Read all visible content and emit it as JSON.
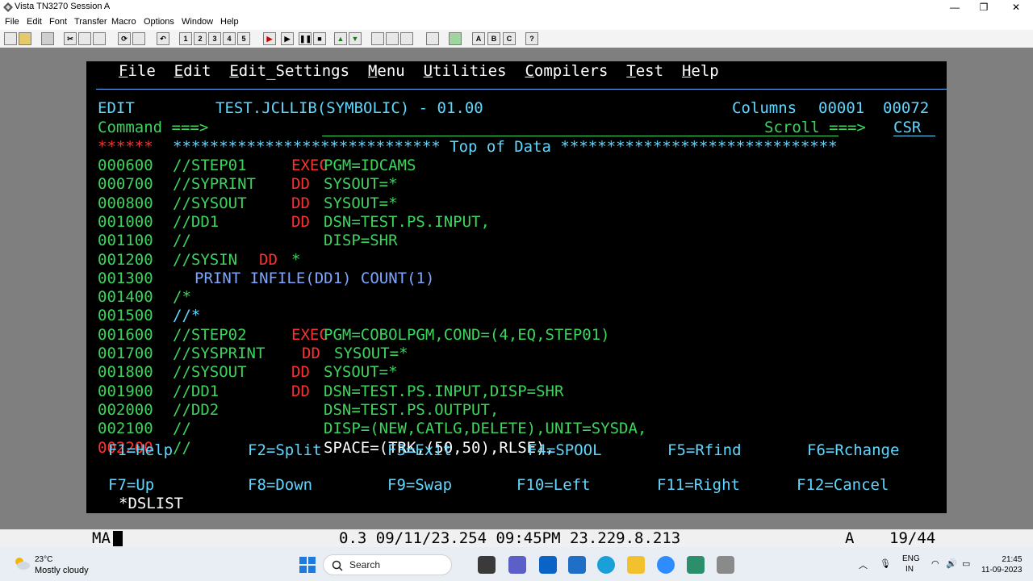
{
  "window": {
    "title": "Vista TN3270 Session A",
    "controls": {
      "minimize": "—",
      "maximize": "❐",
      "close": "✕"
    }
  },
  "menubar": [
    "File",
    "Edit",
    "Font",
    "Transfer",
    "Macro",
    "Options",
    "Window",
    "Help"
  ],
  "toolbar": {
    "session_buttons": [
      "1",
      "2",
      "3",
      "4",
      "5"
    ],
    "letter_buttons": [
      "A",
      "B",
      "C"
    ],
    "help_button": "?"
  },
  "ispf": {
    "action_bar": [
      "File",
      "Edit",
      "Edit_Settings",
      "Menu",
      "Utilities",
      "Compilers",
      "Test",
      "Help"
    ],
    "mode": "EDIT",
    "dataset": "TEST.JCLLIB(SYMBOLIC) - 01.00",
    "columns_label": "Columns",
    "columns_from": "00001",
    "columns_to": "00072",
    "command_label": "Command ===>",
    "command_value": "",
    "scroll_label": "Scroll ===>",
    "scroll_value": "CSR",
    "top_marker": "******",
    "top_banner": "***************************** Top of Data ******************************",
    "lines": [
      {
        "num": "000600",
        "label": "//STEP01",
        "op": "EXEC",
        "params": "PGM=IDCAMS"
      },
      {
        "num": "000700",
        "label": "//SYPRINT",
        "op": "DD",
        "params": "SYSOUT=*"
      },
      {
        "num": "000800",
        "label": "//SYSOUT",
        "op": "DD",
        "params": "SYSOUT=*"
      },
      {
        "num": "001000",
        "label": "//DD1",
        "op": "DD",
        "params": "DSN=TEST.PS.INPUT,"
      },
      {
        "num": "001100",
        "label": "//",
        "op": "",
        "params": "DISP=SHR"
      },
      {
        "num": "001200",
        "label": "//SYSIN",
        "op": "DD",
        "params": "*"
      },
      {
        "num": "001300",
        "label": "",
        "op": "",
        "params": "PRINT INFILE(DD1) COUNT(1)"
      },
      {
        "num": "001400",
        "label": "/*",
        "op": "",
        "params": ""
      },
      {
        "num": "001500",
        "label": "//*",
        "op": "",
        "params": ""
      },
      {
        "num": "001600",
        "label": "//STEP02",
        "op": "EXEC",
        "params": "PGM=COBOLPGM,COND=(4,EQ,STEP01)"
      },
      {
        "num": "001700",
        "label": "//SYSPRINT",
        "op": "DD",
        "params": "SYSOUT=*"
      },
      {
        "num": "001800",
        "label": "//SYSOUT",
        "op": "DD",
        "params": "SYSOUT=*"
      },
      {
        "num": "001900",
        "label": "//DD1",
        "op": "DD",
        "params": "DSN=TEST.PS.INPUT,DISP=SHR"
      },
      {
        "num": "002000",
        "label": "//DD2",
        "op": "",
        "params": "DSN=TEST.PS.OUTPUT,"
      },
      {
        "num": "002100",
        "label": "//",
        "op": "",
        "params": "DISP=(NEW,CATLG,DELETE),UNIT=SYSDA,"
      },
      {
        "num": "002200",
        "label": "//",
        "op": "",
        "params": "SPACE=(TRK,(50,50),RLSE),"
      }
    ],
    "pfkeys_row1": [
      "F1=Help",
      "F2=Split",
      "F3=Exit",
      "F4=SPOOL",
      "F5=Rfind",
      "F6=Rchange"
    ],
    "pfkeys_row2": [
      "F7=Up",
      "F8=Down",
      "F9=Swap",
      "F10=Left",
      "F11=Right",
      "F12=Cancel"
    ],
    "bottom_command": "*DSLIST"
  },
  "statusbar": {
    "left": "MA",
    "info": "0.3 09/11/23.254 09:45PM 23.229.8.213",
    "mode": "A",
    "cursor_pos": "19/44"
  },
  "taskbar": {
    "weather_temp": "23°C",
    "weather_desc": "Mostly cloudy",
    "search_label": "Search",
    "lang_line1": "ENG",
    "lang_line2": "IN",
    "time": "21:45",
    "date": "11-09-2023"
  },
  "colors": {
    "terminal_bg": "#000000",
    "cyan": "#5fd7ff",
    "green": "#3cd45c",
    "red": "#ff3030",
    "blue": "#7fa6ff"
  }
}
